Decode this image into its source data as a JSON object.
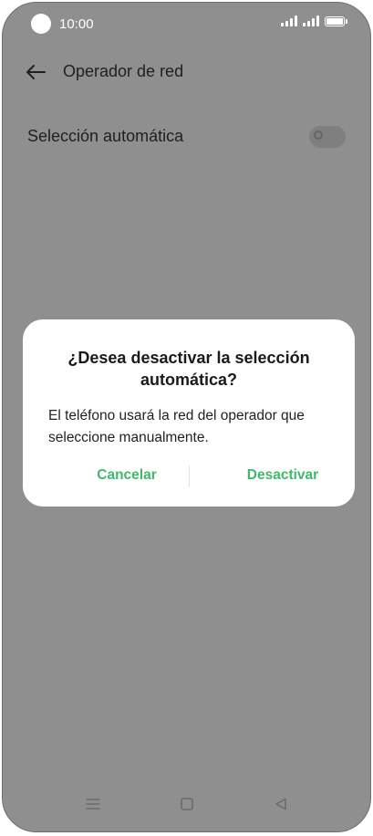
{
  "status_bar": {
    "time": "10:00",
    "icons": [
      "signal-icon",
      "signal-icon",
      "battery-icon"
    ]
  },
  "header": {
    "back_icon": "arrow-left-icon",
    "title": "Operador de red"
  },
  "settings": {
    "auto_selection_label": "Selección automática",
    "auto_selection_enabled": false
  },
  "dialog": {
    "title": "¿Desea desactivar la selección automática?",
    "message": "El teléfono usará la red del operador que seleccione manualmente.",
    "cancel_label": "Cancelar",
    "confirm_label": "Desactivar",
    "accent_color": "#3fb86a"
  },
  "nav_bar": {
    "icons": [
      "menu-icon",
      "home-icon",
      "back-triangle-icon"
    ]
  },
  "colors": {
    "scrim": "#8f8f8f",
    "dialog_bg": "#ffffff",
    "accent": "#3fb86a"
  }
}
